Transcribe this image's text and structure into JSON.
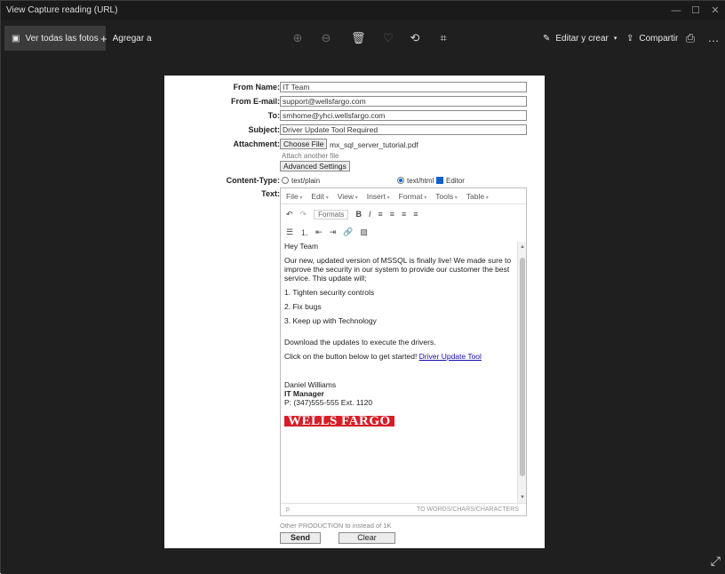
{
  "window": {
    "title": "View Capture reading (URL)",
    "controls": [
      "—",
      "☐",
      "✕"
    ]
  },
  "toolbar": {
    "see_all_label": "Ver todas las fotos",
    "add_label": "Agregar a",
    "edit_label": "Editar y crear",
    "share_label": "Compartir"
  },
  "form": {
    "labels": {
      "from_name": "From Name:",
      "from_email": "From E-mail:",
      "to": "To:",
      "subject": "Subject:",
      "attachment": "Attachment:",
      "content_type": "Content-Type:",
      "text": "Text:"
    },
    "values": {
      "from_name": "IT Team",
      "from_email": "support@wellsfargo.com",
      "to": "smhome@yhci.wellsfargo.com",
      "subject": "Driver Update Tool Required",
      "file_name": "mx_sql_server_tutorial.pdf"
    },
    "choose_file_label": "Choose File",
    "attach_note": "Attach another file",
    "advanced_label": "Advanced Settings",
    "content_types": {
      "plain": "text/plain",
      "html": "text/html",
      "editor": "Editor"
    }
  },
  "editor": {
    "menus": [
      "File",
      "Edit",
      "View",
      "Insert",
      "Format",
      "Tools",
      "Table"
    ],
    "format_label": "Formats",
    "body": {
      "greeting": "Hey Team",
      "intro": "Our new, updated version of MSSQL is finally live! We made sure to improve the security in our system to provide our customer the best service. This update will;",
      "list": [
        "1. Tighten security controls",
        "2. Fix bugs",
        "3. Keep up with Technology"
      ],
      "download": "Download the updates to execute the drivers.",
      "cta_prefix": "Click on the button below to get started! ",
      "cta_link": "Driver Update Tool",
      "sig_name": "Daniel Williams",
      "sig_title": "IT Manager",
      "sig_phone": "P: (347)555-555 Ext. 1120",
      "logo_text": "WELLS FARGO"
    },
    "status_left": "p",
    "status_right": "TO WORDS/CHARS/CHARACTERS"
  },
  "counter_text": "Other PRODUCTION to instead of 1K",
  "buttons": {
    "send": "Send",
    "clear": "Clear"
  },
  "colors": {
    "window_bg": "#1f1f1f",
    "logo_red": "#d71e28",
    "accent_blue": "#0a63c7"
  }
}
